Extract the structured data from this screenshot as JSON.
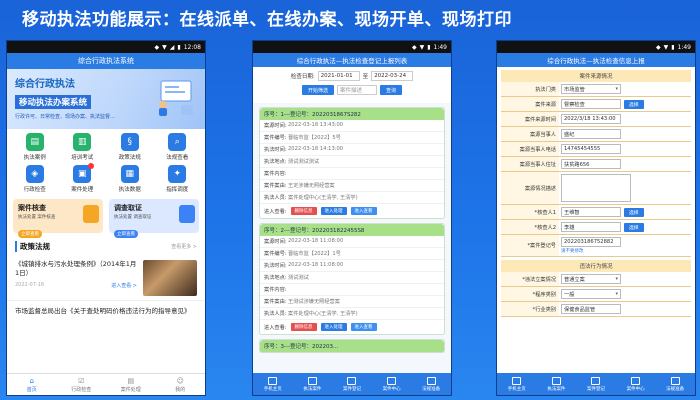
{
  "headline": "移动执法功能展示：在线派单、在线办案、现场开单、现场打印",
  "phone1": {
    "status_time": "12:08",
    "title": "综合行政执法系统",
    "banner": {
      "line1": "综合行政执法",
      "line2": "移动执法办案系统",
      "line3": "行政许可、日常检查、现场办案、执法监督…"
    },
    "grid": [
      {
        "label": "执法案例",
        "icon": "doc-icon",
        "color": "#27b36b",
        "badge": false
      },
      {
        "label": "培训考试",
        "icon": "book-icon",
        "color": "#27b36b",
        "badge": false
      },
      {
        "label": "政策法规",
        "icon": "law-icon",
        "color": "#2b7be4",
        "badge": false
      },
      {
        "label": "法规查看",
        "icon": "search-doc-icon",
        "color": "#2b7be4",
        "badge": false
      },
      {
        "label": "行政检查",
        "icon": "shield-icon",
        "color": "#2b7be4",
        "badge": false
      },
      {
        "label": "案件处理",
        "icon": "case-icon",
        "color": "#2b7be4",
        "badge": true
      },
      {
        "label": "执法数据",
        "icon": "chart-icon",
        "color": "#2b7be4",
        "badge": false
      },
      {
        "label": "指挥调度",
        "icon": "dispatch-icon",
        "color": "#2b7be4",
        "badge": false
      }
    ],
    "cards": [
      {
        "title": "案件核查",
        "sub": "执法处置 案件核查",
        "btn": "立即查看"
      },
      {
        "title": "调查取证",
        "sub": "执法处置 调查取证",
        "btn": "立即查看"
      }
    ],
    "policy_title": "政策法规",
    "policy_more": "查看更多 >",
    "news": [
      {
        "title": "《城镇排水与污水处理条例》（2014年1月1日）",
        "date": "2022-07-16",
        "more": "进入查看 >"
      }
    ],
    "news2": "市场监督总局出台《关于查处明码价格违法行为的指导意见》",
    "tabs": [
      {
        "label": "首页",
        "icon": "home-icon",
        "active": true
      },
      {
        "label": "行政检查",
        "icon": "check-icon",
        "active": false
      },
      {
        "label": "案件处理",
        "icon": "case-tab-icon",
        "active": false
      },
      {
        "label": "我的",
        "icon": "user-icon",
        "active": false
      }
    ]
  },
  "phone2": {
    "status_time": "1:49",
    "title": "综合行政执法—执法检查登记上报列表",
    "filter": {
      "date_label": "检查日期:",
      "date_from": "2021-01-01",
      "date_sep": "至",
      "date_to": "2022-03-24",
      "btn_screen": "开始筛选",
      "desc_placeholder": "案件描述",
      "btn_search": "查询"
    },
    "cases": [
      {
        "head": "序号：1---登记号：2022031867S282",
        "rows": [
          {
            "k": "案源时间:",
            "v": "2022-03-18 13:43:00"
          },
          {
            "k": "案件编号:",
            "v": "晋临市监【2022】5号"
          },
          {
            "k": "执法时间:",
            "v": "2022-03-18 14:13:00"
          },
          {
            "k": "执法地点:",
            "v": "测试测试测试"
          },
          {
            "k": "案件内容:",
            "v": ""
          },
          {
            "k": "案件案由:",
            "v": "王定涉嫌无照经营案"
          },
          {
            "k": "执法人员:",
            "v": "案件处理中心(王清学, 王清学)"
          }
        ],
        "action_label": "进入查看:",
        "actions": [
          "删除信息",
          "进入处理",
          "进入查看"
        ]
      },
      {
        "head": "序号：2---登记号：2022031822455S8",
        "rows": [
          {
            "k": "案源时间:",
            "v": "2022-03-18 11:08:00"
          },
          {
            "k": "案件编号:",
            "v": "晋临市监【2022】1号"
          },
          {
            "k": "执法时间:",
            "v": "2022-03-18 11:08:00"
          },
          {
            "k": "执法地点:",
            "v": "测试测试"
          },
          {
            "k": "案件内容:",
            "v": ""
          },
          {
            "k": "案件案由:",
            "v": "王测试涉嫌无照经营案"
          },
          {
            "k": "执法人员:",
            "v": "案件处理中心(王清学, 王清学)"
          }
        ],
        "action_label": "进入查看:",
        "actions": [
          "删除信息",
          "进入处理",
          "进入查看"
        ]
      }
    ],
    "case3_head": "序号：3---登记号：202203...",
    "tabs": [
      "手机主页",
      "执法案件",
      "案件登记",
      "案件中心",
      "法规准备"
    ]
  },
  "phone3": {
    "status_time": "1:49",
    "title": "综合行政执法—执法检查信息上报",
    "section1": "案件来源情况",
    "section2": "违法行为情况",
    "fields": [
      {
        "k": "执法门类",
        "v": "市场监管",
        "type": "select",
        "btn": "",
        "req": false
      },
      {
        "k": "案件来源",
        "v": "督察检查",
        "type": "input",
        "btn": "选择",
        "req": false
      },
      {
        "k": "案件来源时间",
        "v": "2022/3/18 13:43:00",
        "type": "input",
        "btn": "",
        "req": false
      },
      {
        "k": "案源当事人",
        "v": "盛纪",
        "type": "input",
        "btn": "",
        "req": false
      },
      {
        "k": "案源当事人电话",
        "v": "14745454555",
        "type": "input",
        "btn": "",
        "req": false
      },
      {
        "k": "案源当事人住址",
        "v": "扶贫路656",
        "type": "input",
        "btn": "",
        "req": false
      },
      {
        "k": "案源情况描述",
        "v": "",
        "type": "textarea",
        "btn": "",
        "req": false
      },
      {
        "k": "*核查人1",
        "v": "王维智",
        "type": "input",
        "btn": "选择",
        "req": true
      },
      {
        "k": "*核查人2",
        "v": "李雄",
        "type": "input",
        "btn": "选择",
        "req": true
      },
      {
        "k": "*案件登记号",
        "v": "202203186752882",
        "type": "input",
        "btn": "",
        "req": true,
        "note": "请不要修改"
      }
    ],
    "fields2": [
      {
        "k": "*违法立案情况",
        "v": "普通立案",
        "type": "select"
      },
      {
        "k": "*程序类别",
        "v": "一般",
        "type": "select"
      },
      {
        "k": "*行业类别",
        "v": "保健食品监管",
        "type": "input"
      }
    ],
    "tabs": [
      "手机主页",
      "执法案件",
      "案件登记",
      "案件中心",
      "法规准备"
    ]
  }
}
